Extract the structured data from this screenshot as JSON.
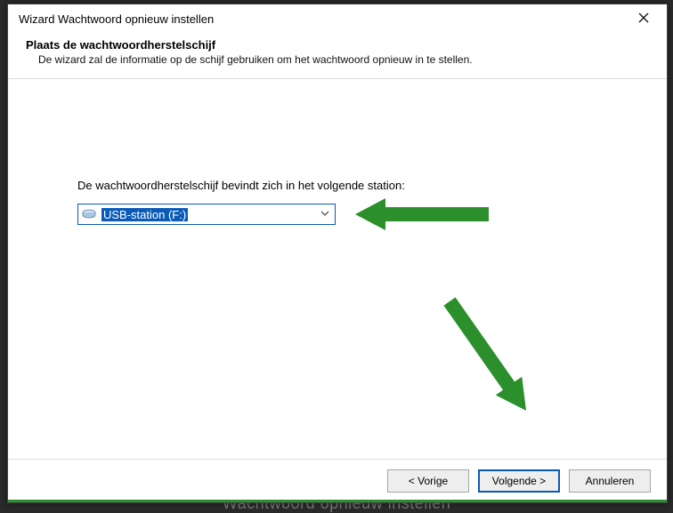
{
  "titlebar": {
    "title": "Wizard Wachtwoord opnieuw instellen"
  },
  "header": {
    "heading": "Plaats de wachtwoordherstelschijf",
    "sub": "De wizard zal de informatie op de schijf gebruiken om het wachtwoord opnieuw in te stellen."
  },
  "body": {
    "prompt": "De wachtwoordherstelschijf bevindt zich in het volgende station:",
    "drive_selected": "USB-station (F:)"
  },
  "footer": {
    "back": "< Vorige",
    "next": "Volgende >",
    "cancel": "Annuleren"
  },
  "background_hint": "Wachtwoord opnieuw instellen"
}
